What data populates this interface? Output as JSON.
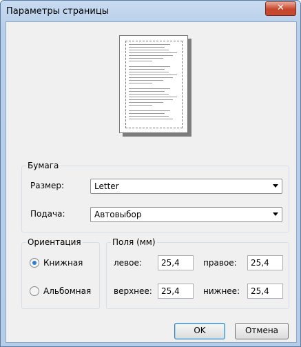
{
  "window": {
    "title": "Параметры страницы"
  },
  "paper": {
    "group_title": "Бумага",
    "size_label": "Размер:",
    "size_value": "Letter",
    "source_label": "Подача:",
    "source_value": "Автовыбор"
  },
  "orientation": {
    "group_title": "Ориентация",
    "portrait_label": "Книжная",
    "landscape_label": "Альбомная",
    "selected": "portrait"
  },
  "margins": {
    "group_title": "Поля (мм)",
    "left_label": "левое:",
    "left_value": "25,4",
    "right_label": "правое:",
    "right_value": "25,4",
    "top_label": "верхнее:",
    "top_value": "25,4",
    "bottom_label": "нижнее:",
    "bottom_value": "25,4"
  },
  "buttons": {
    "ok": "OK",
    "cancel": "Отмена"
  }
}
